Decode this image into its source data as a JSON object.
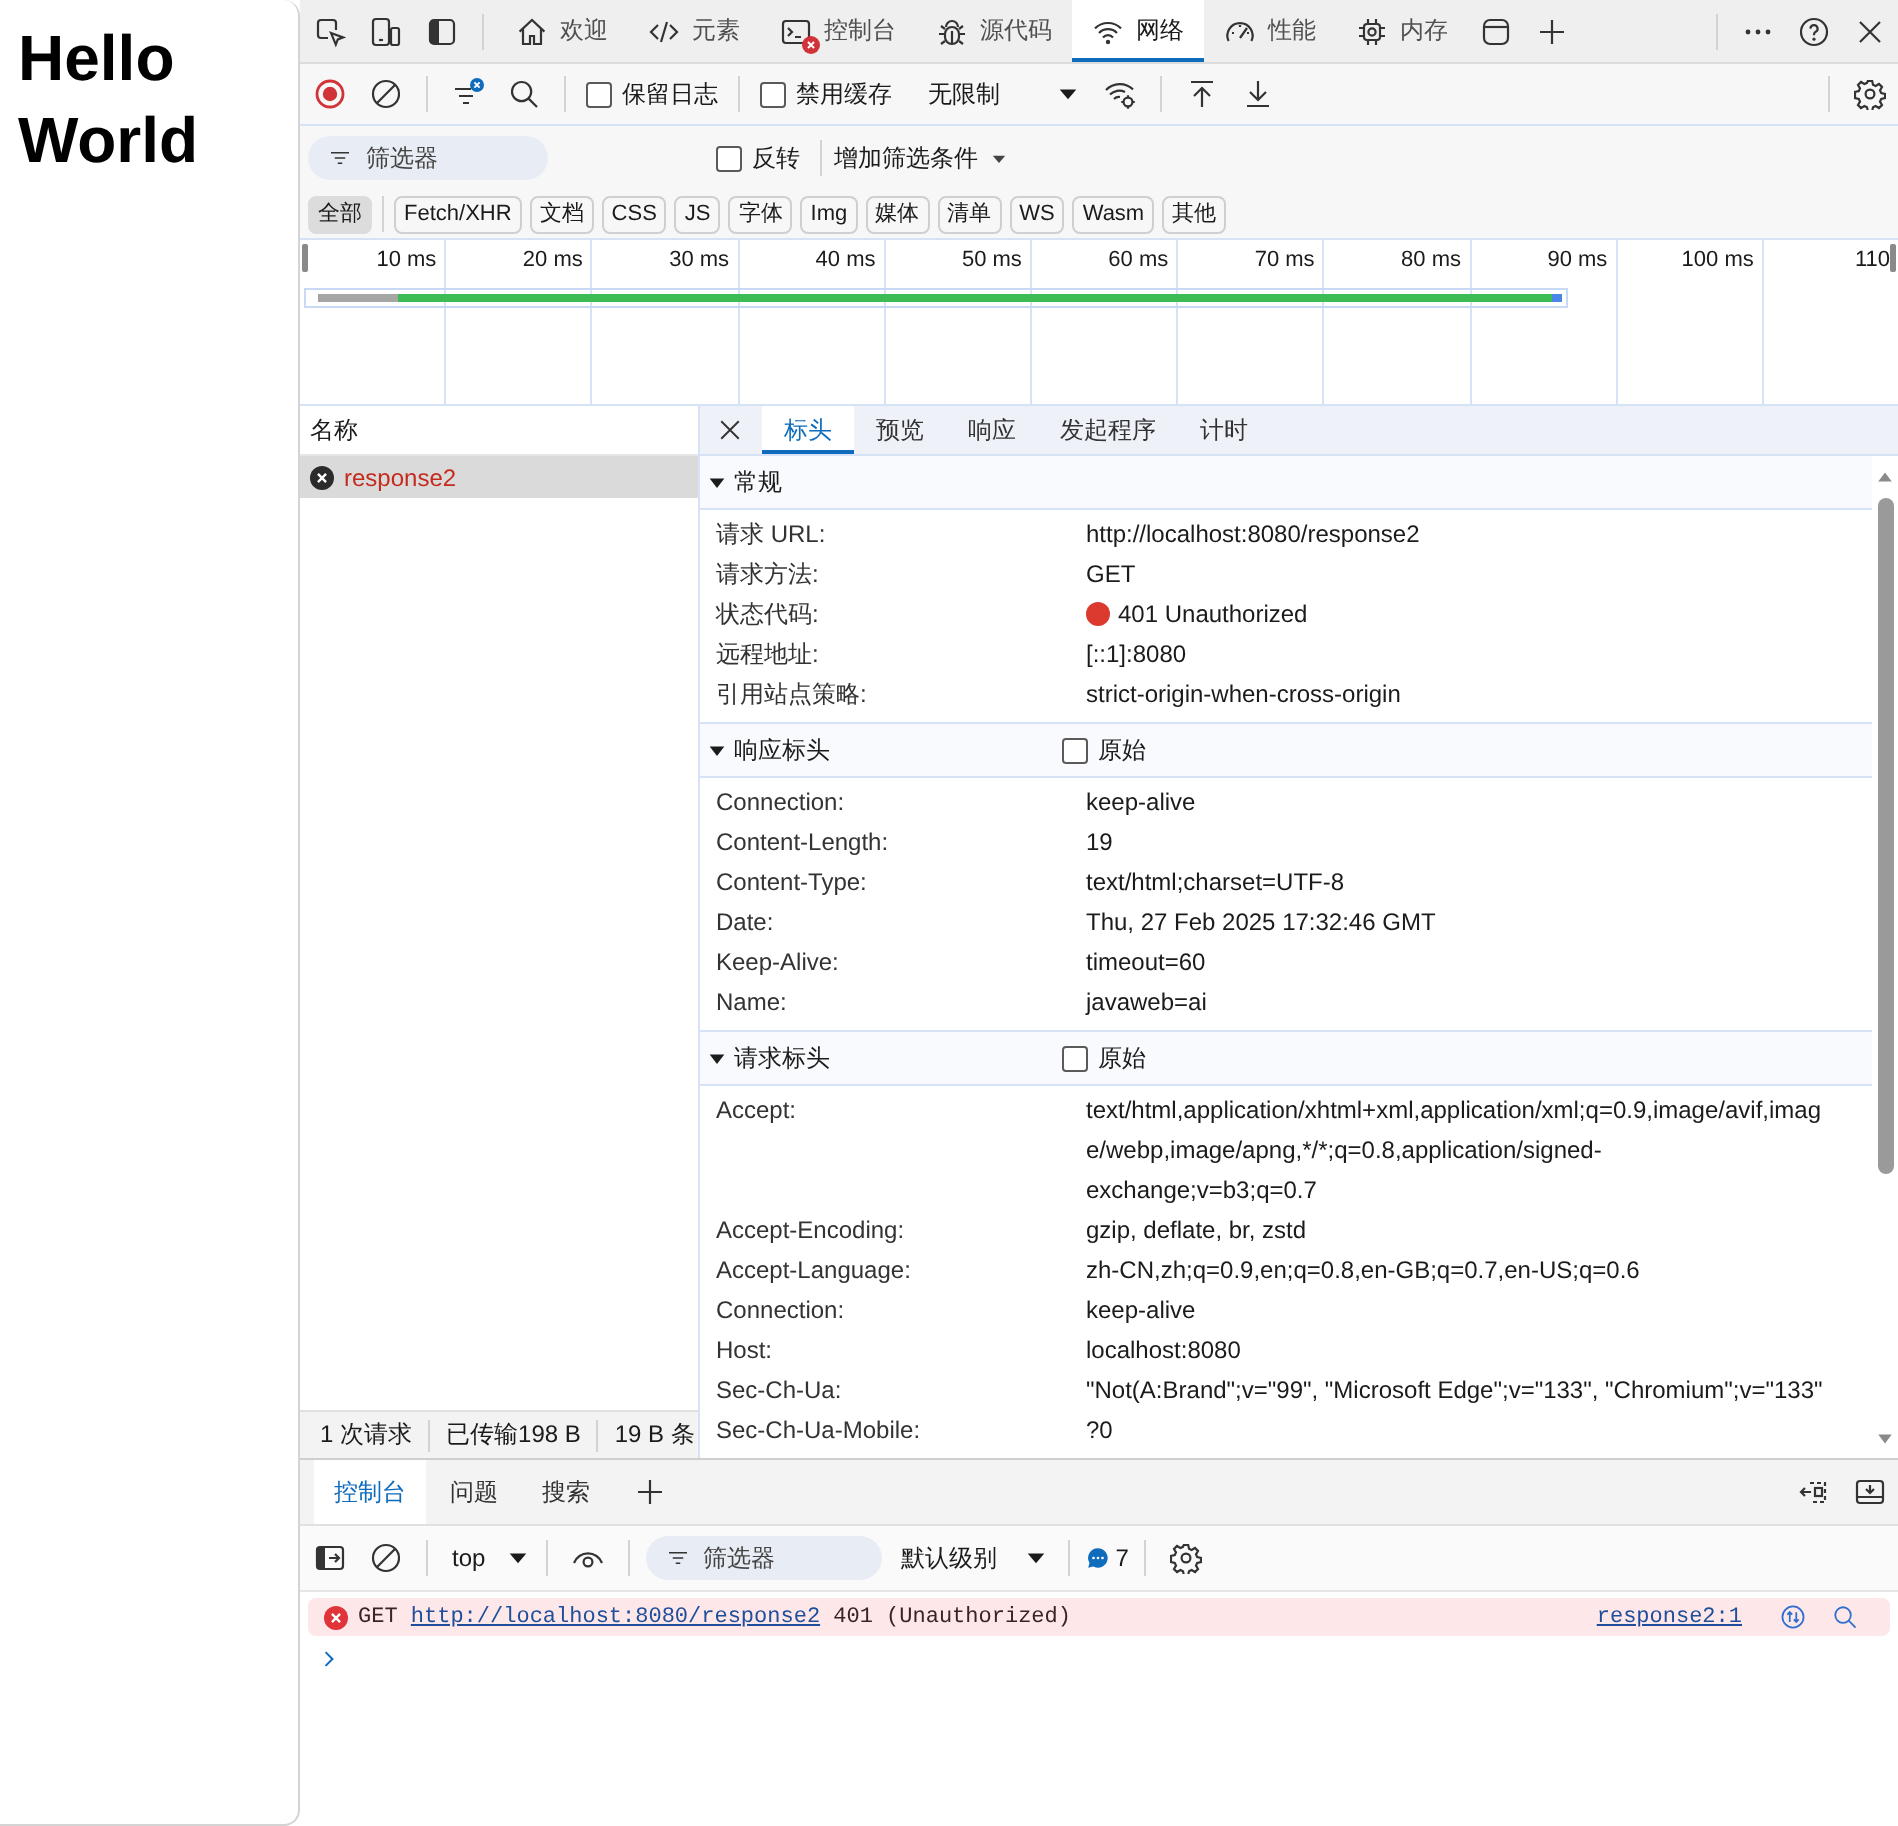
{
  "page": {
    "heading": "Hello World"
  },
  "devtools_tabs": [
    {
      "kind": "welcome",
      "label": "欢迎",
      "selected": false,
      "error_badge": false
    },
    {
      "kind": "elements",
      "label": "元素",
      "selected": false,
      "error_badge": false
    },
    {
      "kind": "console",
      "label": "控制台",
      "selected": false,
      "error_badge": true
    },
    {
      "kind": "sources",
      "label": "源代码",
      "selected": false,
      "error_badge": false
    },
    {
      "kind": "network",
      "label": "网络",
      "selected": true,
      "error_badge": false
    },
    {
      "kind": "performance",
      "label": "性能",
      "selected": false,
      "error_badge": false
    },
    {
      "kind": "memory",
      "label": "内存",
      "selected": false,
      "error_badge": false
    }
  ],
  "network_toolbar": {
    "recording": true,
    "filters_active": true,
    "options": [
      {
        "label": "保留日志",
        "checked": false
      },
      {
        "label": "禁用缓存",
        "checked": false
      }
    ],
    "throttling": "无限制"
  },
  "filter_bar": {
    "filter": {
      "placeholder": "筛选器"
    },
    "invert": {
      "label": "反转",
      "checked": false
    },
    "more_filters": "增加筛选条件"
  },
  "type_filters": [
    {
      "label": "全部",
      "selected": true
    },
    {
      "label": "Fetch/XHR",
      "selected": false
    },
    {
      "label": "文档",
      "selected": false
    },
    {
      "label": "CSS",
      "selected": false
    },
    {
      "label": "JS",
      "selected": false
    },
    {
      "label": "字体",
      "selected": false
    },
    {
      "label": "Img",
      "selected": false
    },
    {
      "label": "媒体",
      "selected": false
    },
    {
      "label": "清单",
      "selected": false
    },
    {
      "label": "WS",
      "selected": false
    },
    {
      "label": "Wasm",
      "selected": false
    },
    {
      "label": "其他",
      "selected": false
    }
  ],
  "timeline": {
    "ticks": [
      "10 ms",
      "20 ms",
      "30 ms",
      "40 ms",
      "50 ms",
      "60 ms",
      "70 ms",
      "80 ms",
      "90 ms",
      "100 ms",
      "110"
    ]
  },
  "request_list": {
    "header": "名称",
    "rows": [
      {
        "name": "response2",
        "selected": true,
        "failed": true
      }
    ],
    "status_bar": [
      "1 次请求",
      "已传输198 B",
      "19 B 条"
    ]
  },
  "details": {
    "tabs": [
      {
        "label": "标头",
        "selected": true
      },
      {
        "label": "预览",
        "selected": false
      },
      {
        "label": "响应",
        "selected": false
      },
      {
        "label": "发起程序",
        "selected": false
      },
      {
        "label": "计时",
        "selected": false
      }
    ],
    "sections": [
      {
        "title": "常规",
        "expanded": true,
        "rows": [
          {
            "key": "请求 URL:",
            "value": "http://localhost:8080/response2"
          },
          {
            "key": "请求方法:",
            "value": "GET"
          },
          {
            "key": "状态代码:",
            "value": "401 Unauthorized",
            "color": "#dc3a2e"
          },
          {
            "key": "远程地址:",
            "value": "[::1]:8080"
          },
          {
            "key": "引用站点策略:",
            "value": "strict-origin-when-cross-origin"
          }
        ]
      },
      {
        "title": "响应标头",
        "expanded": true,
        "raw": {
          "label": "原始",
          "checked": false
        },
        "rows": [
          {
            "key": "Connection:",
            "value": "keep-alive"
          },
          {
            "key": "Content-Length:",
            "value": "19"
          },
          {
            "key": "Content-Type:",
            "value": "text/html;charset=UTF-8"
          },
          {
            "key": "Date:",
            "value": "Thu, 27 Feb 2025 17:32:46 GMT"
          },
          {
            "key": "Keep-Alive:",
            "value": "timeout=60"
          },
          {
            "key": "Name:",
            "value": "javaweb=ai"
          }
        ]
      },
      {
        "title": "请求标头",
        "expanded": true,
        "raw": {
          "label": "原始",
          "checked": false
        },
        "rows": [
          {
            "key": "Accept:",
            "value": "text/html,application/xhtml+xml,application/xml;q=0.9,image/avif,image/webp,image/apng,*/*;q=0.8,application/signed-exchange;v=b3;q=0.7"
          },
          {
            "key": "Accept-Encoding:",
            "value": "gzip, deflate, br, zstd"
          },
          {
            "key": "Accept-Language:",
            "value": "zh-CN,zh;q=0.9,en;q=0.8,en-GB;q=0.7,en-US;q=0.6"
          },
          {
            "key": "Connection:",
            "value": "keep-alive"
          },
          {
            "key": "Host:",
            "value": "localhost:8080"
          },
          {
            "key": "Sec-Ch-Ua:",
            "value": "\"Not(A:Brand\";v=\"99\", \"Microsoft Edge\";v=\"133\", \"Chromium\";v=\"133\""
          },
          {
            "key": "Sec-Ch-Ua-Mobile:",
            "value": "?0"
          }
        ]
      }
    ]
  },
  "drawer": {
    "tabs": [
      {
        "label": "控制台",
        "selected": true
      },
      {
        "label": "问题",
        "selected": false
      },
      {
        "label": "搜索",
        "selected": false
      }
    ],
    "console_toolbar": {
      "context": "top",
      "filter": {
        "placeholder": "筛选器"
      },
      "log_level": "默认级别",
      "message_count": "7"
    },
    "messages": [
      {
        "kind": "error",
        "method": "GET",
        "url": "http://localhost:8080/response2",
        "status": "401 (Unauthorized)",
        "source": "response2:1"
      }
    ]
  }
}
